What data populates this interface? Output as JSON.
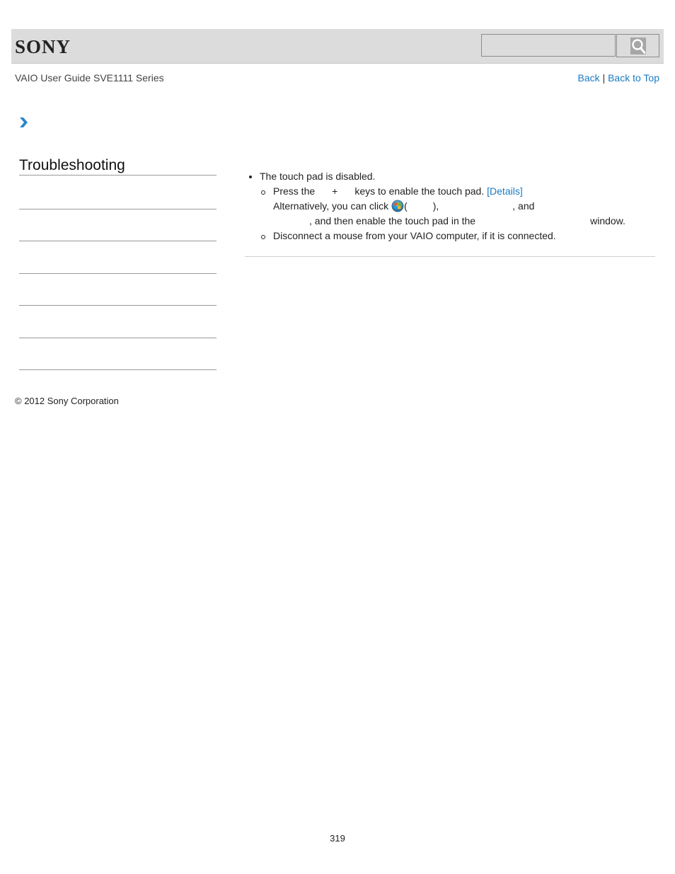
{
  "header": {
    "logo": "SONY",
    "search": {
      "value": "",
      "placeholder": ""
    },
    "search_button_icon": "search-icon"
  },
  "guide_title": "VAIO User Guide SVE1111 Series",
  "nav": {
    "back": "Back",
    "separator": "|",
    "back_to_top": "Back to Top"
  },
  "breadcrumb_icon": "chevron-right-icon",
  "sidebar": {
    "title": "Troubleshooting",
    "item_count": 6
  },
  "content": {
    "bullet1": "The touch pad is disabled.",
    "sub1": {
      "press_the": "Press the",
      "plus": "+",
      "keys_text": "keys to enable the touch pad.",
      "details_link": "[Details]",
      "alt_text": "Alternatively, you can click",
      "open_paren": "(",
      "close_paren": "),",
      "and": ", and",
      "then_text": ", and then enable the touch pad in the",
      "window": "window."
    },
    "sub2": "Disconnect a mouse from your VAIO computer, if it is connected."
  },
  "footer": {
    "copyright": "© 2012 Sony Corporation",
    "page_number": "319"
  }
}
